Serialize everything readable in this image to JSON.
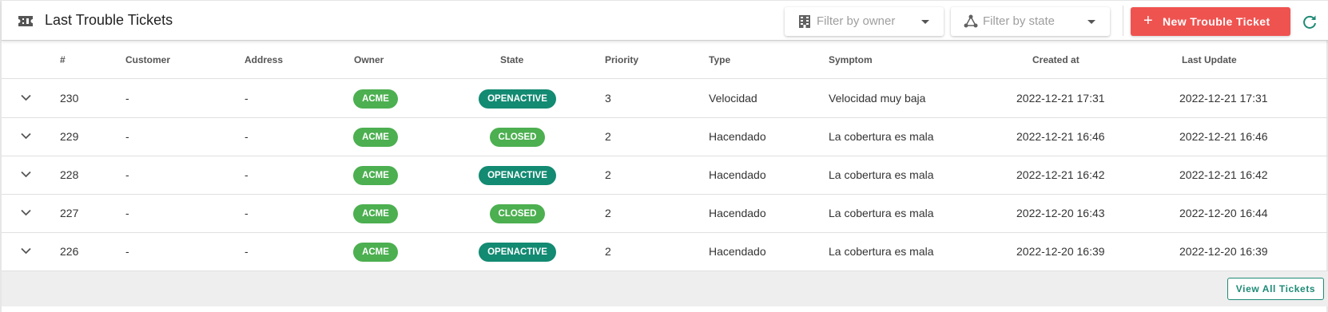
{
  "header": {
    "title": "Last Trouble Tickets",
    "filter_owner_placeholder": "Filter by owner",
    "filter_state_placeholder": "Filter by state",
    "new_ticket_label": "New Trouble Ticket",
    "icons": {
      "title": "ticket-icon",
      "owner_filter": "building-icon",
      "state_filter": "state-graph-icon",
      "refresh": "refresh-icon"
    }
  },
  "table": {
    "columns": [
      "#",
      "Customer",
      "Address",
      "Owner",
      "State",
      "Priority",
      "Type",
      "Symptom",
      "Created at",
      "Last Update"
    ],
    "rows": [
      {
        "id": "230",
        "customer": "-",
        "address": "-",
        "owner": "ACME",
        "state": "OPENACTIVE",
        "priority": "3",
        "type": "Velocidad",
        "symptom": "Velocidad muy baja",
        "created": "2022-12-21 17:31",
        "updated": "2022-12-21 17:31"
      },
      {
        "id": "229",
        "customer": "-",
        "address": "-",
        "owner": "ACME",
        "state": "CLOSED",
        "priority": "2",
        "type": "Hacendado",
        "symptom": "La cobertura es mala",
        "created": "2022-12-21 16:46",
        "updated": "2022-12-21 16:46"
      },
      {
        "id": "228",
        "customer": "-",
        "address": "-",
        "owner": "ACME",
        "state": "OPENACTIVE",
        "priority": "2",
        "type": "Hacendado",
        "symptom": "La cobertura es mala",
        "created": "2022-12-21 16:42",
        "updated": "2022-12-21 16:42"
      },
      {
        "id": "227",
        "customer": "-",
        "address": "-",
        "owner": "ACME",
        "state": "CLOSED",
        "priority": "2",
        "type": "Hacendado",
        "symptom": "La cobertura es mala",
        "created": "2022-12-20 16:43",
        "updated": "2022-12-20 16:44"
      },
      {
        "id": "226",
        "customer": "-",
        "address": "-",
        "owner": "ACME",
        "state": "OPENACTIVE",
        "priority": "2",
        "type": "Hacendado",
        "symptom": "La cobertura es mala",
        "created": "2022-12-20 16:39",
        "updated": "2022-12-20 16:39"
      }
    ]
  },
  "footer": {
    "view_all_label": "View All Tickets"
  },
  "colors": {
    "new_button": "#ef5350",
    "chip_green": "#4caf50",
    "chip_teal": "#138a72",
    "view_all_border": "#1e8a76"
  }
}
